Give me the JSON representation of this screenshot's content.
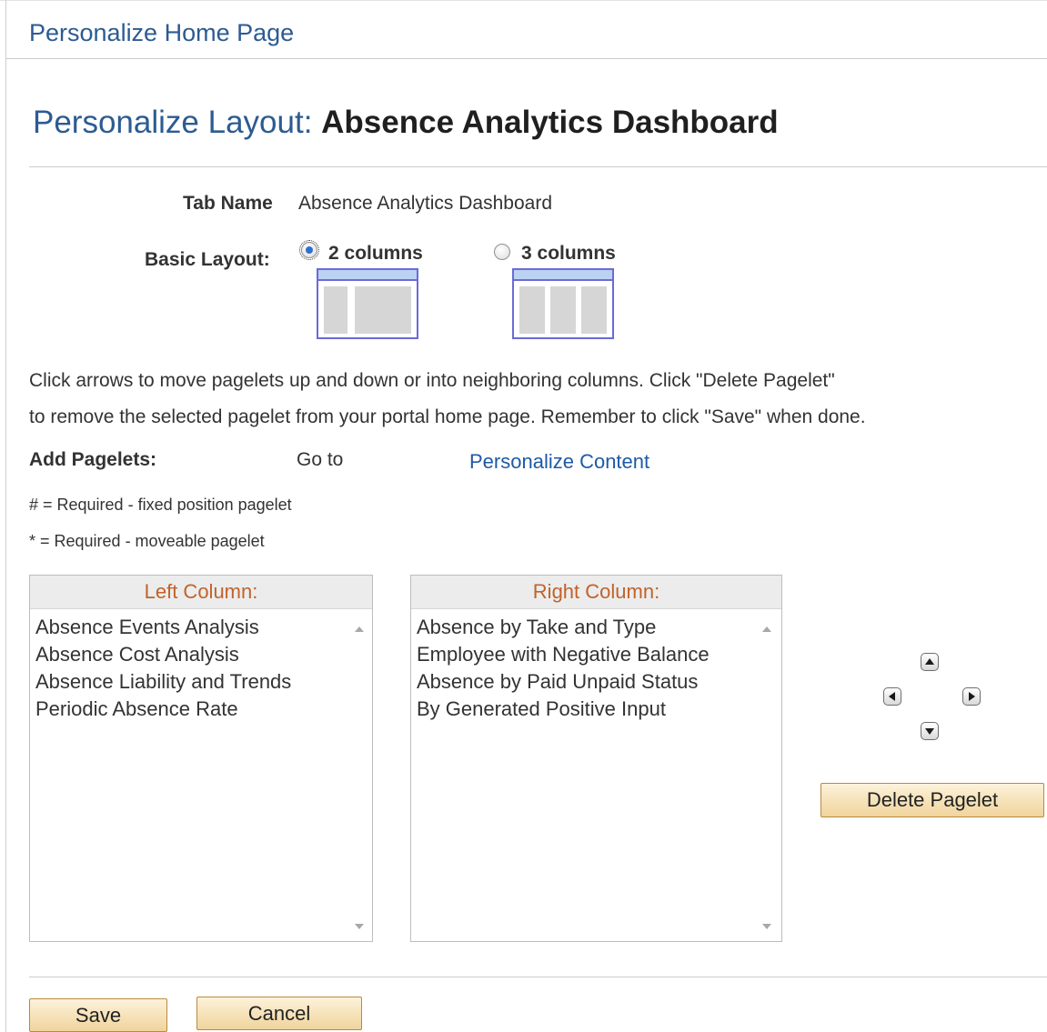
{
  "header": {
    "title": "Personalize Home Page"
  },
  "layout_title": {
    "prefix": "Personalize Layout:",
    "name": "Absence Analytics Dashboard"
  },
  "tab_name": {
    "label": "Tab Name",
    "value": "Absence Analytics Dashboard"
  },
  "basic_layout": {
    "label": "Basic Layout:",
    "options": [
      {
        "label": "2 columns",
        "selected": true
      },
      {
        "label": "3 columns",
        "selected": false
      }
    ]
  },
  "instructions": {
    "line1": "Click arrows to move pagelets up and down or into neighboring columns. Click \"Delete Pagelet\"",
    "line2": "to remove the selected pagelet from your portal home page. Remember to click \"Save\" when done."
  },
  "add_pagelets": {
    "label": "Add Pagelets:",
    "goto": "Go to",
    "link": "Personalize Content"
  },
  "legend": {
    "fixed": "# = Required - fixed position pagelet",
    "moveable": "* = Required - moveable pagelet"
  },
  "left_column": {
    "header": "Left Column:",
    "items": [
      "Absence Events Analysis",
      "Absence Cost Analysis",
      "Absence Liability and Trends",
      "Periodic Absence Rate"
    ]
  },
  "right_column": {
    "header": "Right Column:",
    "items": [
      "Absence by Take and Type",
      "Employee with Negative Balance",
      "Absence by Paid Unpaid Status",
      "By Generated Positive Input"
    ]
  },
  "actions": {
    "delete": "Delete Pagelet",
    "save": "Save",
    "cancel": "Cancel"
  },
  "colors": {
    "link": "#1e5aa7",
    "column_header": "#c0632b",
    "button_bg": "#f5deb0",
    "thumb_border": "#6b6bd6"
  }
}
